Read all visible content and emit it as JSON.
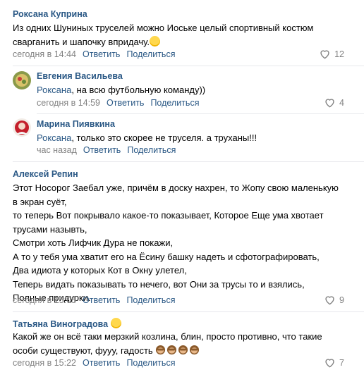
{
  "comments": [
    {
      "author": "Роксана Куприна",
      "text": "Из одних Шуниных труселей можно Иоське целый спортивный костюм\nсварганить и шапочку впридачу.",
      "time": "сегодня в 14:44",
      "reply_label": "Ответить",
      "share_label": "Поделиться",
      "likes": "12"
    },
    {
      "author": "Евгения Васильева",
      "reply_to": "Роксана",
      "text": ", на всю футбольную команду))",
      "time": "сегодня в 14:59",
      "reply_label": "Ответить",
      "share_label": "Поделиться",
      "likes": "4"
    },
    {
      "author": "Марина Пиявкина",
      "reply_to": "Роксана",
      "text": ", только это скорее не труселя. а труханы!!!",
      "time": "час назад",
      "reply_label": "Ответить",
      "share_label": "Поделиться"
    },
    {
      "author": "Алексей Репин",
      "text": "Этот Носорог Заебал уже, причём в доску нахрен, то Жопу свою маленькую\nв экран суёт,\nто теперь Вот покрывало какое-то показывает, Которое Еще ума хвотает\nтрусами назывть,\nСмотри хоть Лифчик Дура не покажи,\nА то у тебя ума хватит его на Ёсину башку надеть и сфотографировать,\nДва идиота у которых Кот в Окну улетел,\nТеперь видать показывать то нечего, вот Они за трусы то и взялись,\nПолные придурки.",
      "time": "сегодня в 15:05",
      "reply_label": "Ответить",
      "share_label": "Поделиться",
      "likes": "9"
    },
    {
      "author": "Татьяна Виноградова",
      "text": "Какой же он всё таки мерзкий козлина, блин, просто противно, что такие\nособи существуют, фууу, гадость",
      "time": "сегодня в 15:22",
      "reply_label": "Ответить",
      "share_label": "Поделиться",
      "likes": "7"
    }
  ],
  "colors": {
    "link": "#2a5885",
    "meta": "#828282",
    "divider": "#e7e8ec"
  },
  "icons": [
    "heart-icon",
    "smile-emoji",
    "monkey-emoji"
  ]
}
